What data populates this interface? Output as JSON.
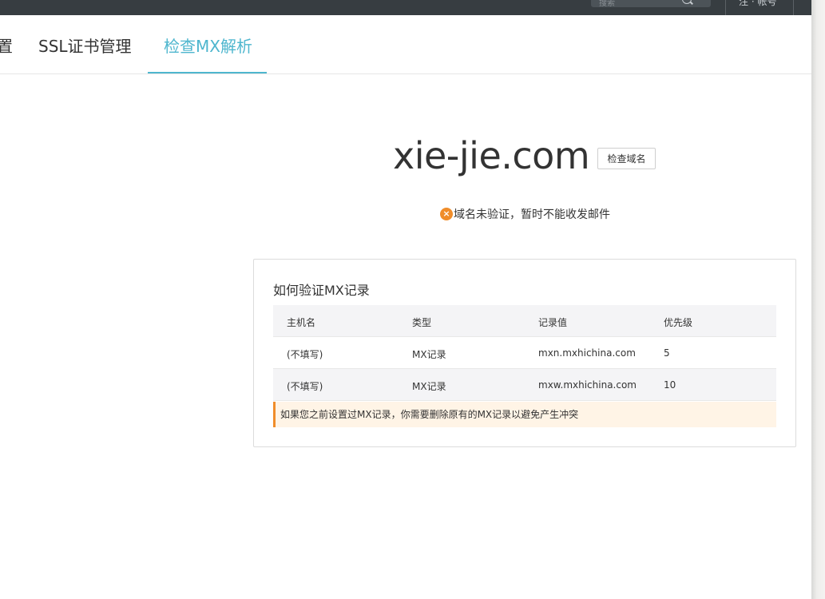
{
  "topbar": {
    "search_placeholder": "搜索",
    "user_label": "注 · 帐号"
  },
  "tabs": [
    {
      "label": "置"
    },
    {
      "label": "SSL证书管理"
    },
    {
      "label": "检查MX解析"
    }
  ],
  "domain": {
    "name": "xie-jie.com",
    "check_button": "检查域名",
    "status_text": "域名未验证，暂时不能收发邮件",
    "status_icon": "error-circle-icon"
  },
  "mx_card": {
    "title": "如何验证MX记录",
    "columns": [
      "主机名",
      "类型",
      "记录值",
      "优先级"
    ],
    "rows": [
      [
        "(不填写)",
        "MX记录",
        "mxn.mxhichina.com",
        "5"
      ],
      [
        "(不填写)",
        "MX记录",
        "mxw.mxhichina.com",
        "10"
      ]
    ],
    "warning": "如果您之前设置过MX记录，你需要删除原有的MX记录以避免产生冲突"
  },
  "colors": {
    "accent": "#4eb6ce",
    "warning": "#f08d2a",
    "topbar": "#373d41"
  }
}
